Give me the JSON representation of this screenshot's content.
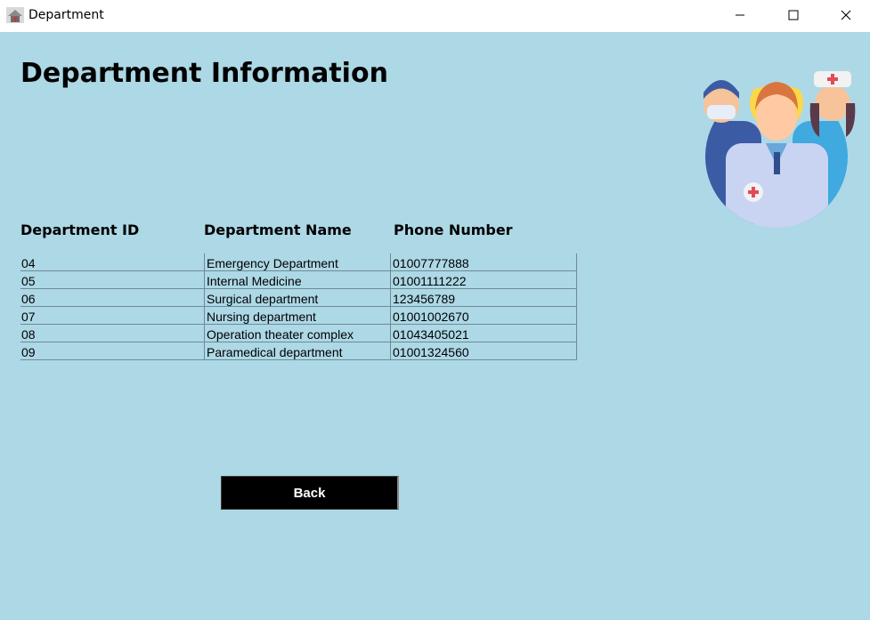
{
  "window": {
    "title": "Department",
    "app_icon": "hospital-app-icon",
    "controls": {
      "minimize_icon": "minimize-icon",
      "maximize_icon": "maximize-icon",
      "close_icon": "close-icon"
    }
  },
  "page": {
    "title": "Department Information",
    "illustration": "medical-staff-illustration"
  },
  "table": {
    "columns": [
      "Department ID",
      "Department Name",
      "Phone Number"
    ],
    "rows": [
      {
        "id": "04",
        "name": "Emergency Department",
        "phone": "01007777888"
      },
      {
        "id": "05",
        "name": "Internal Medicine",
        "phone": "01001111222"
      },
      {
        "id": "06",
        "name": "Surgical department",
        "phone": "123456789"
      },
      {
        "id": "07",
        "name": "Nursing department",
        "phone": "01001002670"
      },
      {
        "id": "08",
        "name": "Operation theater complex",
        "phone": "01043405021"
      },
      {
        "id": "09",
        "name": "Paramedical department",
        "phone": "01001324560"
      }
    ]
  },
  "actions": {
    "back_label": "Back"
  },
  "colors": {
    "background": "#ADD8E6",
    "button_bg": "#000000",
    "button_text": "#FFFFFF"
  }
}
